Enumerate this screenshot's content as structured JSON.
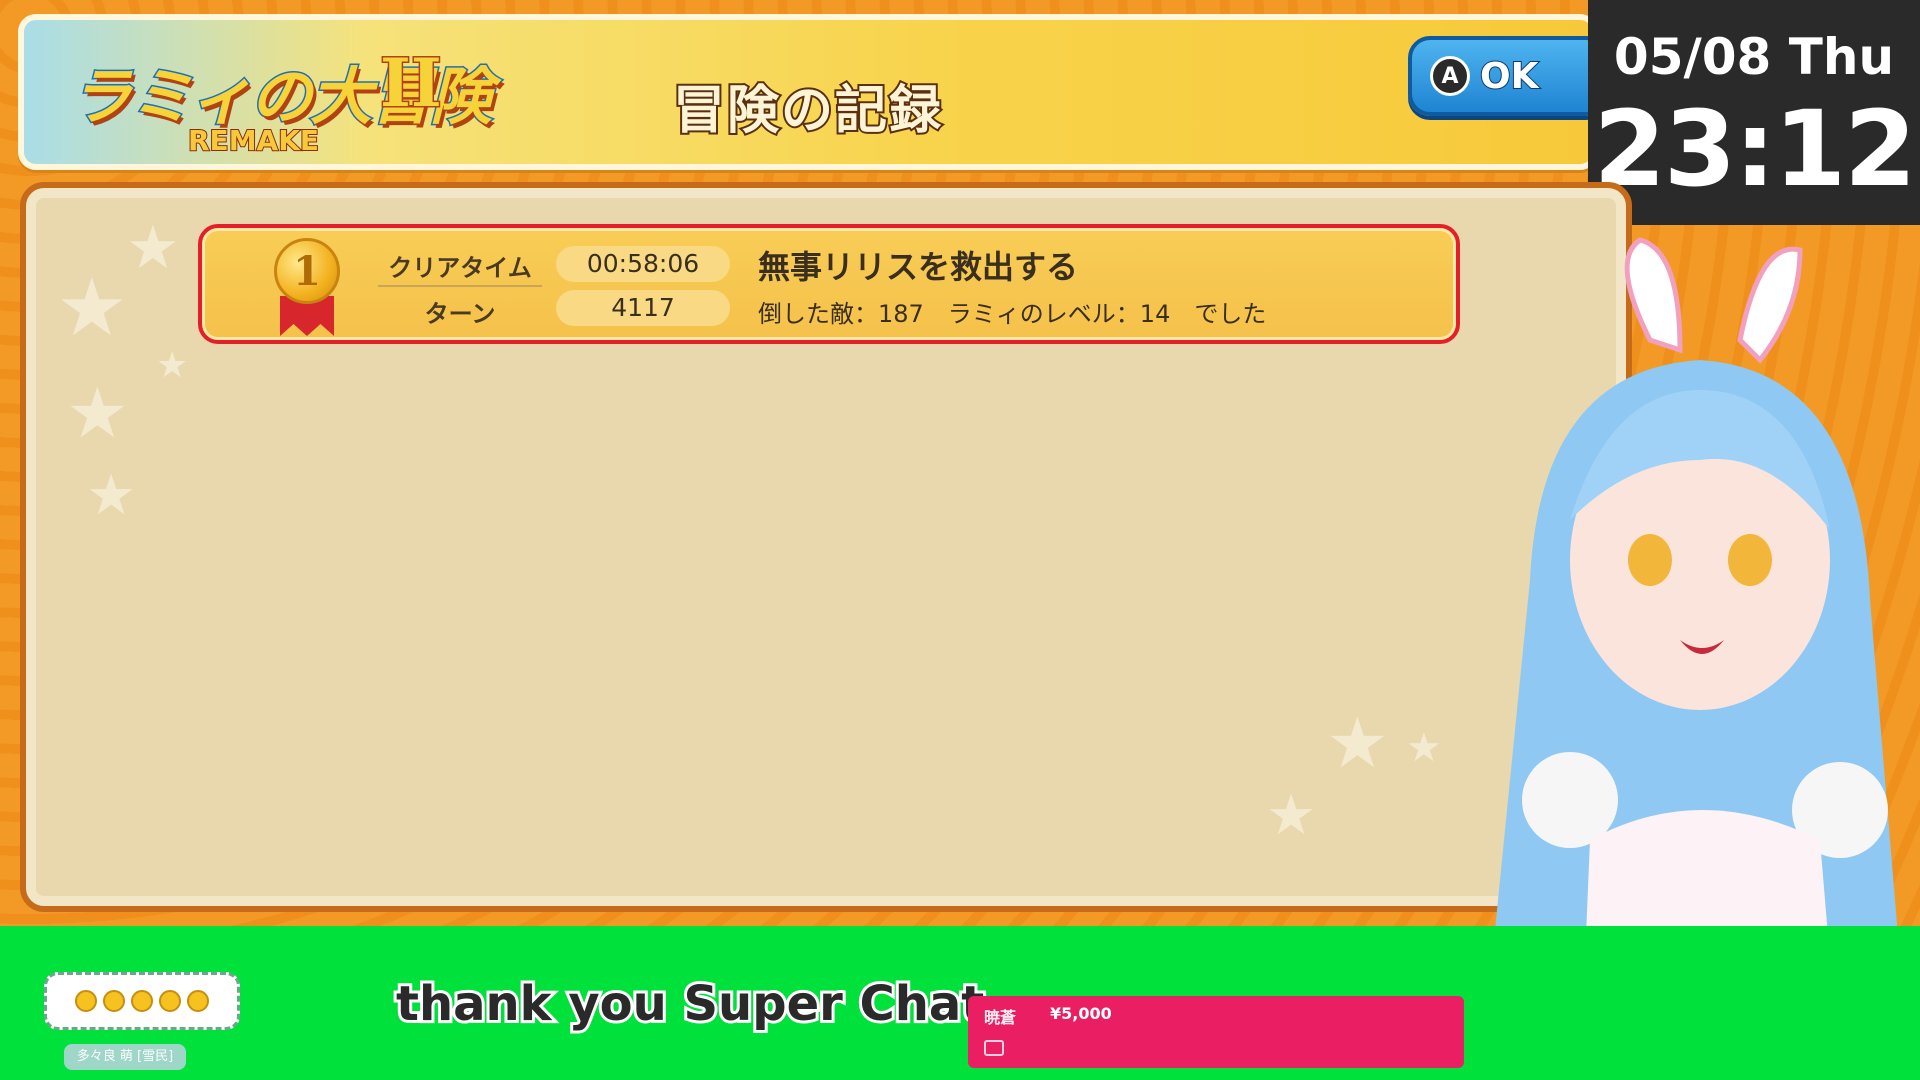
{
  "game": {
    "logo_title": "ラミィの大冒険",
    "logo_numeral": "II",
    "logo_subtitle": "REMAKE"
  },
  "header": {
    "title": "冒険の記録",
    "ok_button_icon": "A",
    "ok_button_label": "OK"
  },
  "clock": {
    "date": "05/08 Thu",
    "time": "23:12"
  },
  "record": {
    "rank": "1",
    "clear_time_label": "クリアタイム",
    "clear_time_value": "00:58:06",
    "turn_label": "ターン",
    "turn_value": "4117",
    "title": "無事リリスを救出する",
    "detail": "倒した敵：187　ラミィのレベル：14　でした"
  },
  "stream": {
    "caption": "thank you Super Chat",
    "superchat_name": "暁蒼",
    "superchat_amount": "¥5,000",
    "name_tag": "多々良 萌 [雪民]"
  },
  "colors": {
    "frame_orange": "#f39a26",
    "record_border": "#e41f2a",
    "greenscreen": "#00e13c",
    "superchat": "#e91e63"
  }
}
